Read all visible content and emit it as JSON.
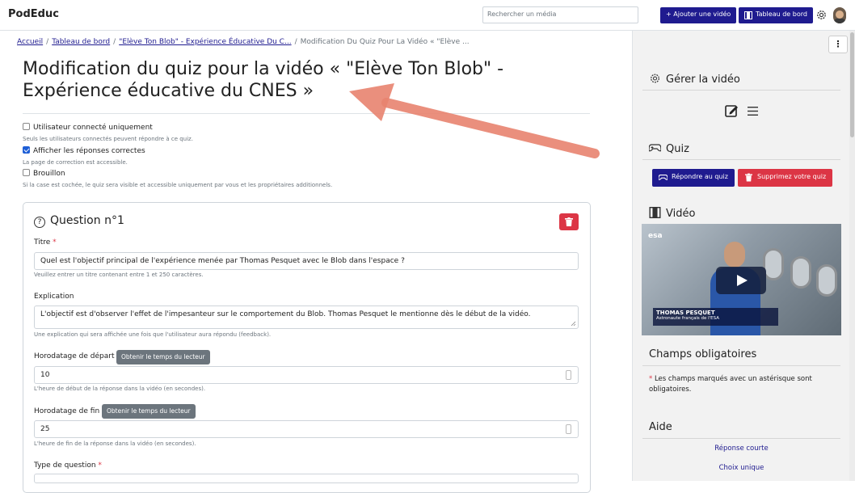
{
  "header": {
    "brand": "PodEduc",
    "search_placeholder": "Rechercher un média",
    "add_video_label": "+ Ajouter une vidéo",
    "dashboard_label": "Tableau de bord"
  },
  "breadcrumb": {
    "home": "Accueil",
    "dashboard": "Tableau de bord",
    "video": "\"Elève Ton Blob\" - Expérience Éducative Du C...",
    "current": "Modification Du Quiz Pour La Vidéo « \"Elève ..."
  },
  "page": {
    "title": "Modification du quiz pour la vidéo « \"Elève Ton Blob\" - Expérience éducative du CNES »"
  },
  "options": [
    {
      "label": "Utilisateur connecté uniquement",
      "help": "Seuls les utilisateurs connectés peuvent répondre à ce quiz.",
      "checked": false
    },
    {
      "label": "Afficher les réponses correctes",
      "help": "La page de correction est accessible.",
      "checked": true
    },
    {
      "label": "Brouillon",
      "help": "Si la case est cochée, le quiz sera visible et accessible uniquement par vous et les propriétaires additionnels.",
      "checked": false
    }
  ],
  "question": {
    "heading": "Question n°1",
    "title_label": "Titre",
    "required_mark": "*",
    "title_value": "Quel est l'objectif principal de l'expérience menée par Thomas Pesquet avec le Blob dans l'espace ?",
    "title_help": "Veuillez entrer un titre contenant entre 1 et 250 caractères.",
    "explanation_label": "Explication",
    "explanation_value": "L'objectif est d'observer l'effet de l'impesanteur sur le comportement du Blob. Thomas Pesquet le mentionne dès le début de la vidéo.",
    "explanation_help": "Une explication qui sera affichée une fois que l'utilisateur aura répondu (feedback).",
    "start_label": "Horodatage de départ",
    "start_value": "10",
    "start_help": "L'heure de début de la réponse dans la vidéo (en secondes).",
    "end_label": "Horodatage de fin",
    "end_value": "25",
    "end_help": "L'heure de fin de la réponse dans la vidéo (en secondes).",
    "player_time_label": "Obtenir le temps du lecteur",
    "type_label": "Type de question"
  },
  "sidebar": {
    "manage_heading": "Gérer la vidéo",
    "quiz_heading": "Quiz",
    "answer_quiz_label": "Répondre au quiz",
    "delete_quiz_label": "Supprimez votre quiz",
    "video_heading": "Vidéo",
    "video_caption_name": "THOMAS PESQUET",
    "video_caption_sub": "Astronaute français de l'ESA",
    "video_logo": "esa",
    "required_heading": "Champs obligatoires",
    "required_text": "Les champs marqués avec un astérisque sont obligatoires.",
    "help_heading": "Aide",
    "help_links": [
      "Réponse courte",
      "Choix unique"
    ]
  },
  "colors": {
    "primary": "#1f1b8f",
    "danger": "#dc3545",
    "secondary": "#6c757d",
    "annotation_arrow": "#e8836f"
  }
}
